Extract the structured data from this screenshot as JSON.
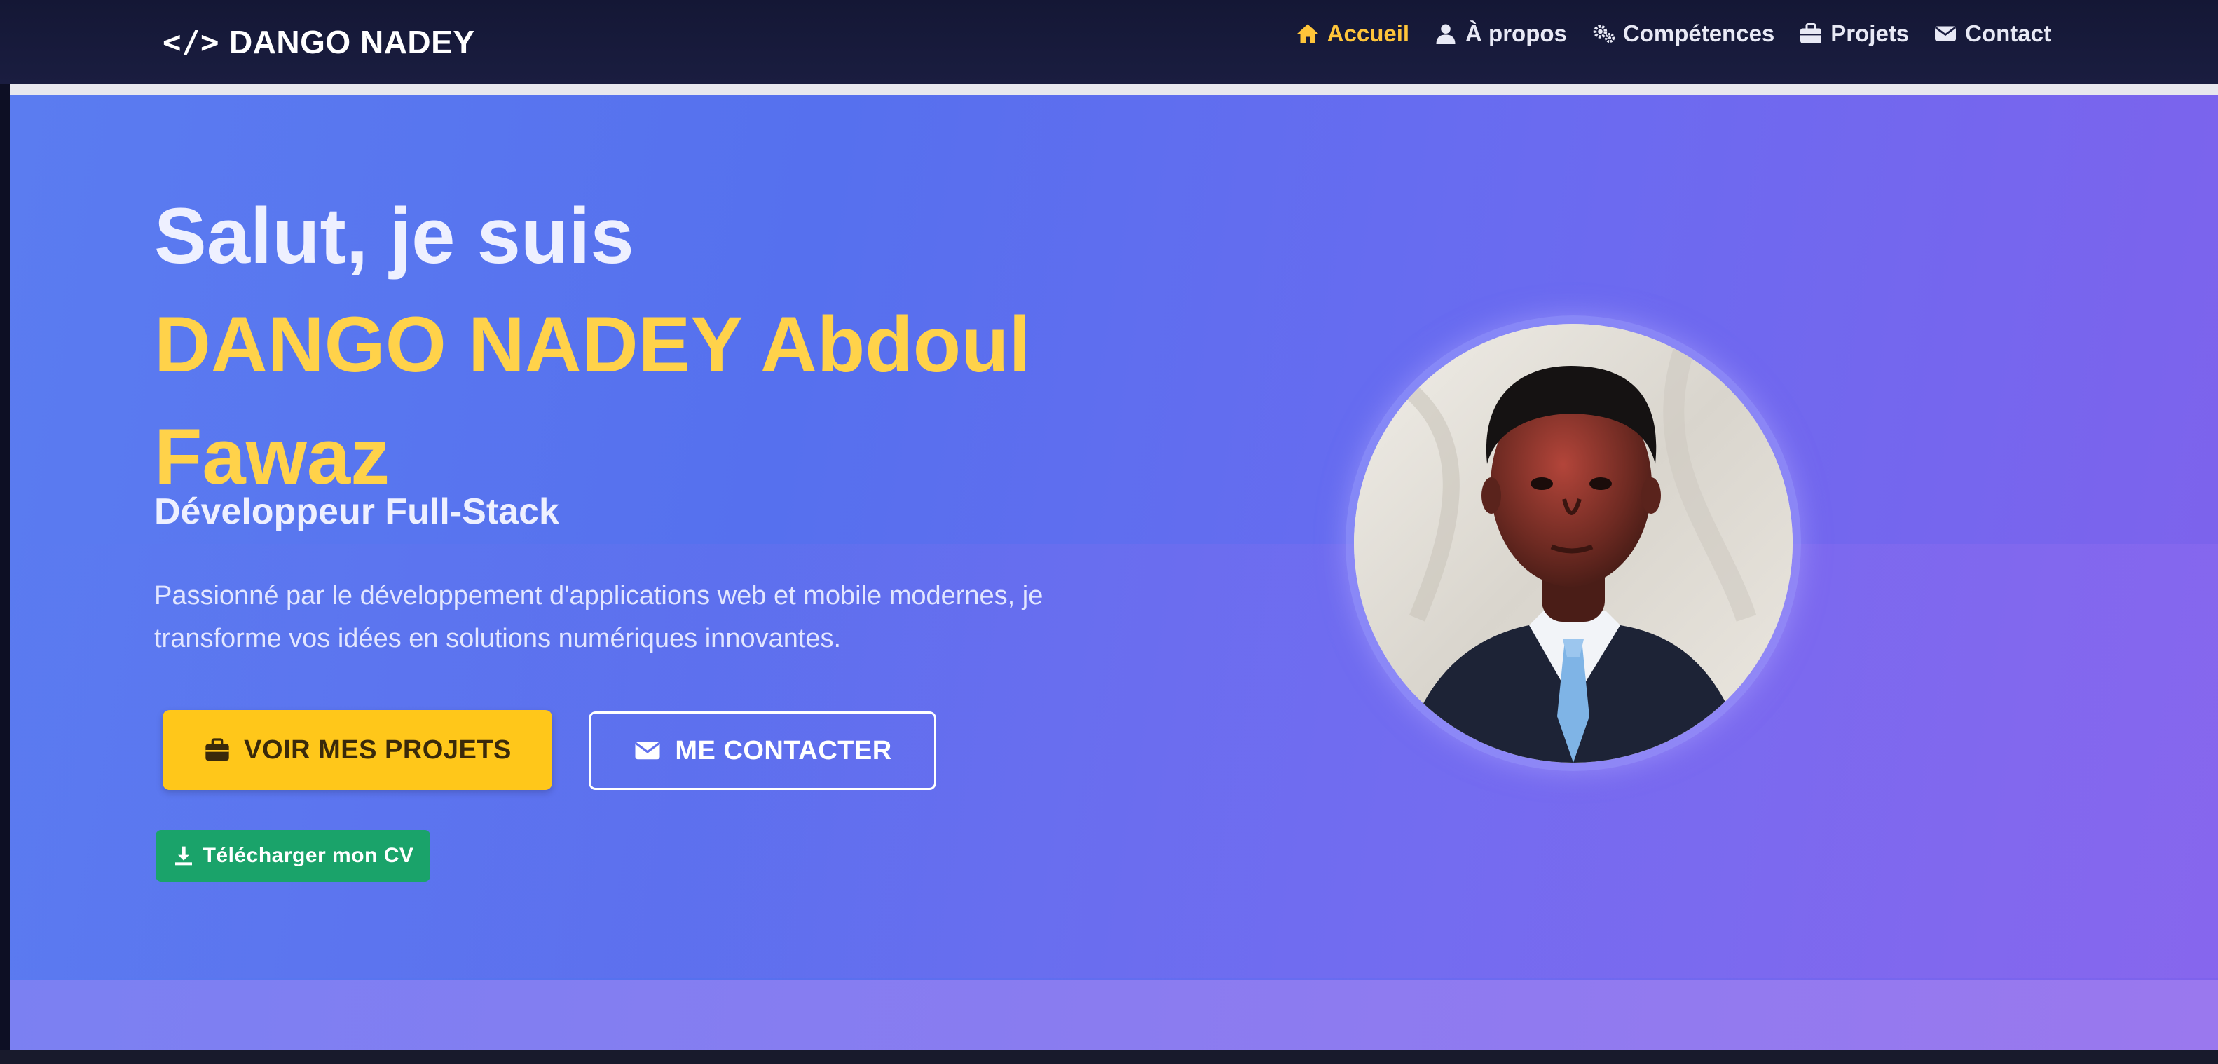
{
  "brand": {
    "icon": "</>",
    "name": "DANGO NADEY"
  },
  "nav": {
    "items": [
      {
        "label": "Accueil",
        "icon": "home-icon",
        "active": true
      },
      {
        "label": "À propos",
        "icon": "user-icon",
        "active": false
      },
      {
        "label": "Compétences",
        "icon": "gears-icon",
        "active": false
      },
      {
        "label": "Projets",
        "icon": "briefcase-icon",
        "active": false
      },
      {
        "label": "Contact",
        "icon": "envelope-icon",
        "active": false
      }
    ]
  },
  "hero": {
    "greeting": "Salut, je suis",
    "name": "DANGO NADEY Abdoul Fawaz",
    "role": "Développeur Full-Stack",
    "description": "Passionné par le développement d'applications web et mobile modernes, je transforme vos idées en solutions numériques innovantes.",
    "projects_button": "VOIR MES PROJETS",
    "contact_button": "ME CONTACTER",
    "cv_button": "Télécharger mon CV"
  },
  "colors": {
    "accent": "#ffc53a",
    "name_color": "#ffd24a",
    "primary_button": "#ffc71a",
    "cv_button": "#1aa36a",
    "hero_start": "#5b7cf0",
    "hero_end": "#7f62ec",
    "navbar": "#141735"
  }
}
